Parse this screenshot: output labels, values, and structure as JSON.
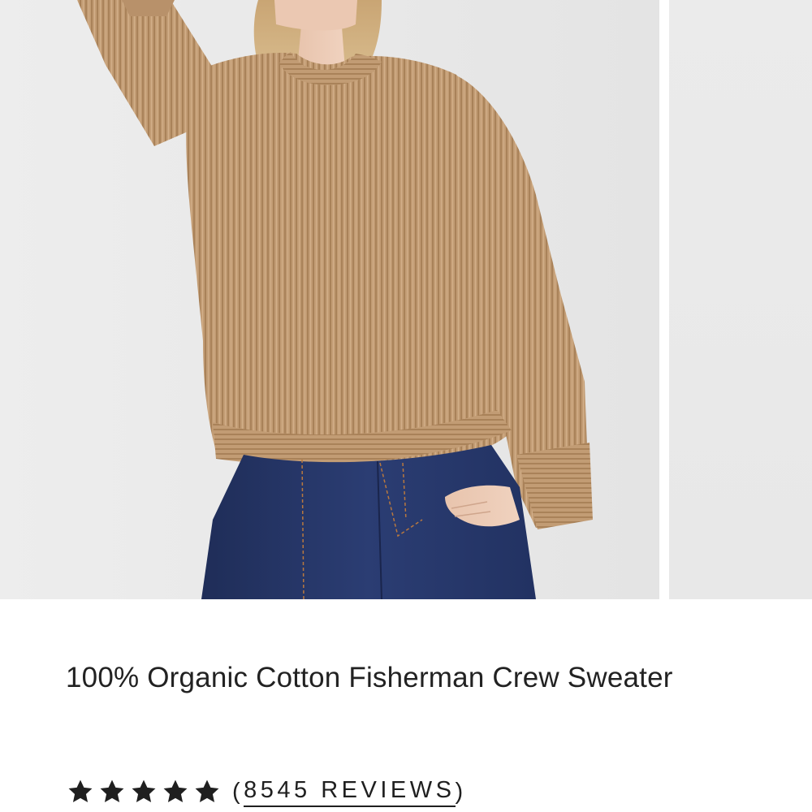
{
  "product": {
    "title": "100% Organic Cotton Fisherman Crew Sweater",
    "rating": {
      "stars": 5,
      "max_stars": 5,
      "open_paren": "(",
      "review_count_label": "8545 REVIEWS",
      "close_paren": ")"
    }
  },
  "gallery": {
    "slides": [
      "product-photo",
      "product-photo"
    ]
  },
  "colors": {
    "sweater": "#c09a72",
    "denim": "#27386b",
    "background": "#e9e9e9",
    "text": "#222222"
  }
}
